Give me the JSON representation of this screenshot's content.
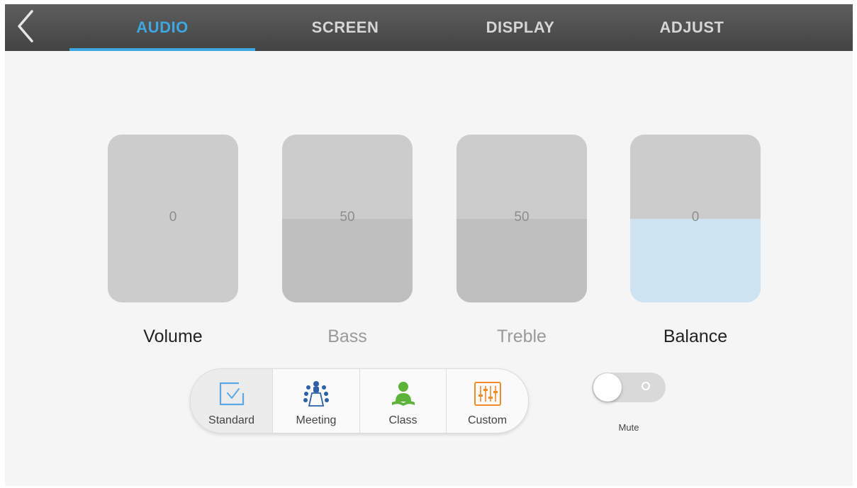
{
  "header": {
    "tabs": [
      {
        "label": "AUDIO",
        "active": true
      },
      {
        "label": "SCREEN",
        "active": false
      },
      {
        "label": "DISPLAY",
        "active": false
      },
      {
        "label": "ADJUST",
        "active": false
      }
    ],
    "accent_color": "#3fa7e0"
  },
  "sliders": [
    {
      "label": "Volume",
      "value": "0",
      "level": 0.0,
      "enabled": true,
      "fill_color": "#cccccc"
    },
    {
      "label": "Bass",
      "value": "50",
      "level": 0.5,
      "enabled": false,
      "fill_color": "#c0bfbf"
    },
    {
      "label": "Treble",
      "value": "50",
      "level": 0.5,
      "enabled": false,
      "fill_color": "#c0bfbf"
    },
    {
      "label": "Balance",
      "value": "0",
      "level": 0.5,
      "enabled": true,
      "fill_color": "#cfe4f3"
    }
  ],
  "sound_modes": {
    "selected": "Standard",
    "items": [
      {
        "label": "Standard",
        "icon": "checkbox-check-icon",
        "color": "#5aa9e6"
      },
      {
        "label": "Meeting",
        "icon": "meeting-group-icon",
        "color": "#2f5fa8"
      },
      {
        "label": "Class",
        "icon": "class-reader-icon",
        "color": "#5bb33a"
      },
      {
        "label": "Custom",
        "icon": "equalizer-icon",
        "color": "#f08a24"
      }
    ]
  },
  "mute": {
    "label": "Mute",
    "on": false
  }
}
